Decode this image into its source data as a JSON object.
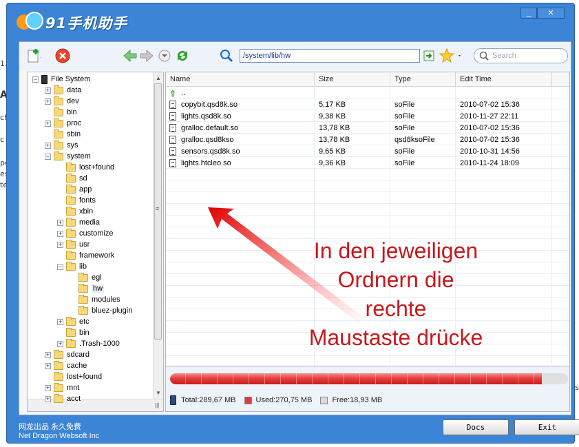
{
  "app": {
    "title": "91手机助手"
  },
  "toolbar": {
    "path_value": "/system/lib/hw",
    "search_placeholder": "Search"
  },
  "tree": [
    {
      "label": "File System",
      "depth": 0,
      "toggle": "−",
      "icon": "phone-icon"
    },
    {
      "label": "data",
      "depth": 1,
      "toggle": "+"
    },
    {
      "label": "dev",
      "depth": 1,
      "toggle": "+"
    },
    {
      "label": "bin",
      "depth": 1,
      "toggle": ""
    },
    {
      "label": "proc",
      "depth": 1,
      "toggle": "+"
    },
    {
      "label": "sbin",
      "depth": 1,
      "toggle": ""
    },
    {
      "label": "sys",
      "depth": 1,
      "toggle": "+"
    },
    {
      "label": "system",
      "depth": 1,
      "toggle": "−"
    },
    {
      "label": "lost+found",
      "depth": 2,
      "toggle": ""
    },
    {
      "label": "sd",
      "depth": 2,
      "toggle": ""
    },
    {
      "label": "app",
      "depth": 2,
      "toggle": ""
    },
    {
      "label": "fonts",
      "depth": 2,
      "toggle": ""
    },
    {
      "label": "xbin",
      "depth": 2,
      "toggle": ""
    },
    {
      "label": "media",
      "depth": 2,
      "toggle": "+"
    },
    {
      "label": "customize",
      "depth": 2,
      "toggle": "+"
    },
    {
      "label": "usr",
      "depth": 2,
      "toggle": "+"
    },
    {
      "label": "framework",
      "depth": 2,
      "toggle": ""
    },
    {
      "label": "lib",
      "depth": 2,
      "toggle": "−"
    },
    {
      "label": "egl",
      "depth": 3,
      "toggle": ""
    },
    {
      "label": "hw",
      "depth": 3,
      "toggle": "",
      "selected": true
    },
    {
      "label": "modules",
      "depth": 3,
      "toggle": ""
    },
    {
      "label": "bluez-plugin",
      "depth": 3,
      "toggle": ""
    },
    {
      "label": "etc",
      "depth": 2,
      "toggle": "+"
    },
    {
      "label": "bin",
      "depth": 2,
      "toggle": ""
    },
    {
      "label": ".Trash-1000",
      "depth": 2,
      "toggle": "+"
    },
    {
      "label": "sdcard",
      "depth": 1,
      "toggle": "+"
    },
    {
      "label": "cache",
      "depth": 1,
      "toggle": "+"
    },
    {
      "label": "lost+found",
      "depth": 1,
      "toggle": ""
    },
    {
      "label": "mnt",
      "depth": 1,
      "toggle": "+"
    },
    {
      "label": "acct",
      "depth": 1,
      "toggle": "+"
    }
  ],
  "list": {
    "columns": [
      "Name",
      "Size",
      "Type",
      "Edit Time"
    ],
    "up_label": "..",
    "rows": [
      {
        "name": "copybit.qsd8k.so",
        "size": "5,17 KB",
        "type": "soFile",
        "time": "2010-07-02 15:36"
      },
      {
        "name": "lights.qsd8k.so",
        "size": "9,38 KB",
        "type": "soFile",
        "time": "2010-11-27 22:11"
      },
      {
        "name": "gralloc.default.so",
        "size": "13,78 KB",
        "type": "soFile",
        "time": "2010-07-02 15:36"
      },
      {
        "name": "gralloc.qsd8kso",
        "size": "13,78 KB",
        "type": "qsd8ksoFile",
        "time": "2010-07-02 15:36"
      },
      {
        "name": "sensors.qsd8k.so",
        "size": "9,65 KB",
        "type": "soFile",
        "time": "2010-10-31 14:56"
      },
      {
        "name": "lights.htcleo.so",
        "size": "9,36 KB",
        "type": "soFile",
        "time": "2010-11-24 18:09"
      }
    ]
  },
  "storage": {
    "total": "Total:289,67 MB",
    "used": "Used:270,75 MB",
    "free": "Free:18,93 MB",
    "used_fraction": 0.935,
    "used_color": "#e33a3a",
    "free_color": "#d9d9d9"
  },
  "footer": {
    "cn": "网龙出品 永久免费",
    "en": "Net Dragon Websoft Inc",
    "docs_label": "Docs",
    "exit_label": "Exit"
  },
  "annotation": {
    "lines": [
      "In den jeweiligen",
      "Ordnern die",
      "rechte",
      "Maustaste drücke"
    ],
    "color": "#c8171b"
  },
  "colors": {
    "window": "#3c84d6",
    "accent": "#c8171b"
  }
}
